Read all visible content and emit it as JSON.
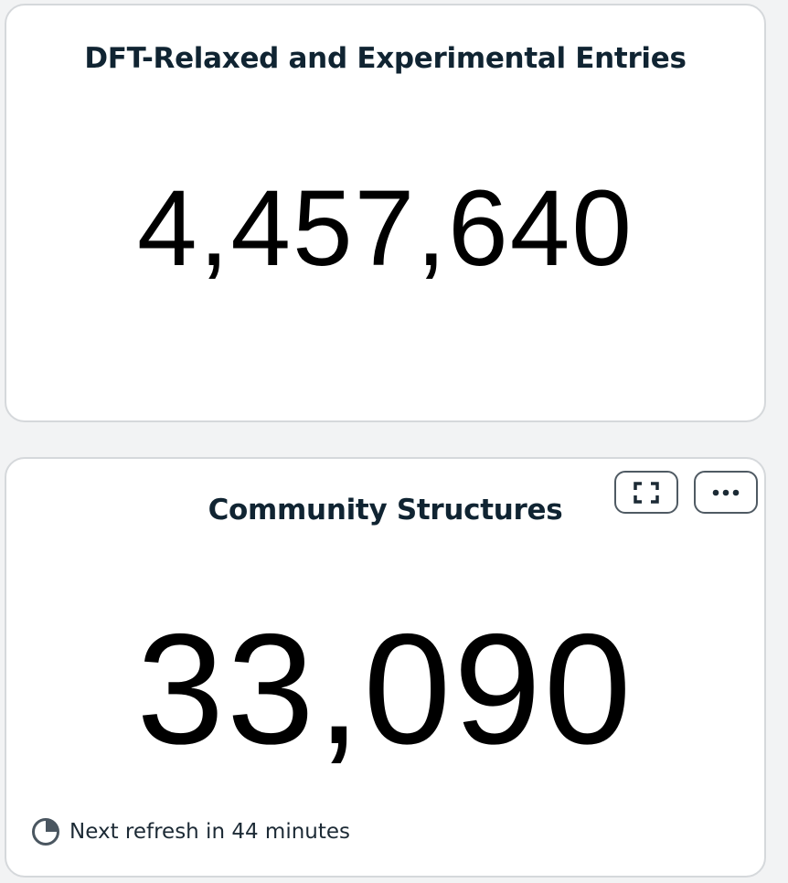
{
  "cards": [
    {
      "title": "DFT-Relaxed and Experimental Entries",
      "value": "4,457,640"
    },
    {
      "title": "Community Structures",
      "value": "33,090",
      "footer": "Next refresh in 44 minutes",
      "actions": {
        "expand_icon": "expand-icon",
        "more_icon": "more-options-icon"
      }
    }
  ],
  "colors": {
    "background": "#f2f3f4",
    "card": "#ffffff",
    "border": "#d5d8db",
    "title": "#102432",
    "value": "#000000"
  }
}
